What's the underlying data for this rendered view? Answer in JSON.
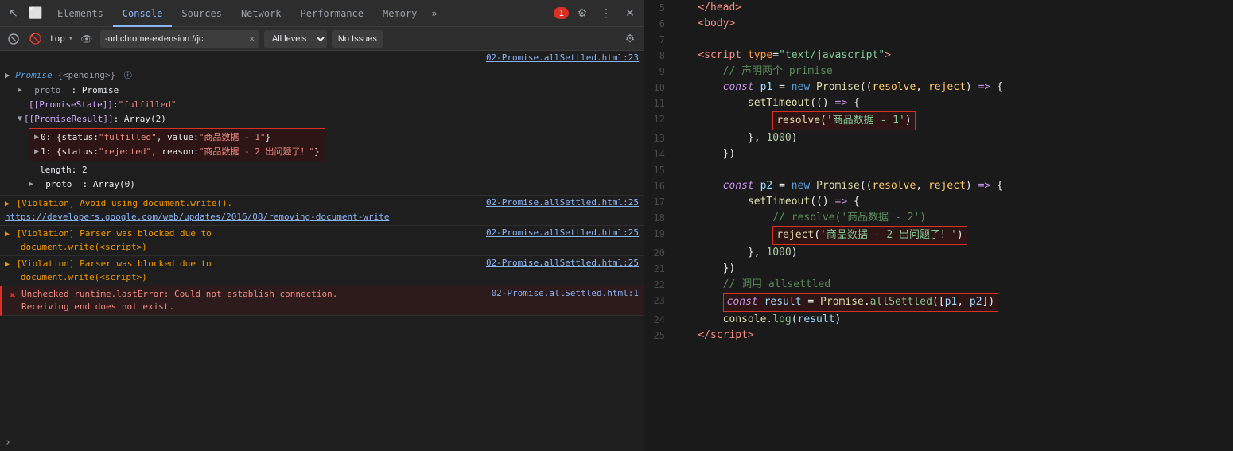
{
  "devtools": {
    "toolbar": {
      "cursor_icon": "↖",
      "inspect_icon": "⬜",
      "tabs": [
        "Elements",
        "Console",
        "Sources",
        "Network",
        "Performance",
        "Memory"
      ],
      "active_tab": "Console",
      "more_icon": "»",
      "error_count": "1",
      "settings_icon": "⚙",
      "more_options_icon": "⋮",
      "close_icon": "✕"
    },
    "console_toolbar": {
      "clear_icon": "🚫",
      "filter_placeholder": "-url:chrome-extension://jc",
      "filter_has_x": true,
      "eye_icon": "👁",
      "top_label": "top",
      "top_dropdown": "▾",
      "log_level": "All levels",
      "no_issues": "No Issues",
      "settings_icon": "⚙"
    },
    "output": {
      "file_ref": "02-Promise.allSettled.html:23",
      "promise_header": "Promise {<pending>}",
      "proto_label": "▶ __proto__: Promise",
      "state_label": "[[PromiseState]]: \"fulfilled\"",
      "result_label": "▼ [[PromiseResult]]: Array(2)",
      "item0_label": "▶ 0: {status: \"fulfilled\", value: \"商品数据 - 1\"}",
      "item1_label": "▶ 1: {status: \"rejected\", reason: \"商品数据 - 2 出问题了！\"}",
      "length_label": "length: 2",
      "proto2_label": "▶ __proto__: Array(0)",
      "violations": [
        {
          "text": "▶ [Violation] Avoid using document.write(). ",
          "link_text": "https://developers.google.com/web/updates/2016/08/removing-document-write",
          "location": "02-Promise.allSettled.html:25"
        },
        {
          "text": "▶ [Violation] Parser was blocked due to document.write(<script>)",
          "link_text": "",
          "location": "02-Promise.allSettled.html:25"
        },
        {
          "text": "▶ [Violation] Parser was blocked due to document.write(<script>)",
          "link_text": "",
          "location": "02-Promise.allSettled.html:25"
        }
      ],
      "error_text": "Unchecked runtime.lastError: Could not establish connection. Receiving end does not exist.",
      "error_location": "02-Promise.allSettled.html:1"
    }
  },
  "code": {
    "lines": [
      {
        "num": "5",
        "html_raw": "5"
      },
      {
        "num": "6",
        "html_raw": "6"
      },
      {
        "num": "7",
        "html_raw": "7"
      },
      {
        "num": "8",
        "html_raw": "8"
      },
      {
        "num": "9",
        "html_raw": "9"
      },
      {
        "num": "10",
        "html_raw": "10"
      },
      {
        "num": "11",
        "html_raw": "11"
      },
      {
        "num": "12",
        "html_raw": "12"
      },
      {
        "num": "13",
        "html_raw": "13"
      },
      {
        "num": "14",
        "html_raw": "14"
      },
      {
        "num": "15",
        "html_raw": "15"
      },
      {
        "num": "16",
        "html_raw": "16"
      },
      {
        "num": "17",
        "html_raw": "17"
      },
      {
        "num": "18",
        "html_raw": "18"
      },
      {
        "num": "19",
        "html_raw": "19"
      },
      {
        "num": "20",
        "html_raw": "20"
      },
      {
        "num": "21",
        "html_raw": "21"
      },
      {
        "num": "22",
        "html_raw": "22"
      },
      {
        "num": "23",
        "html_raw": "23"
      },
      {
        "num": "24",
        "html_raw": "24"
      }
    ]
  }
}
